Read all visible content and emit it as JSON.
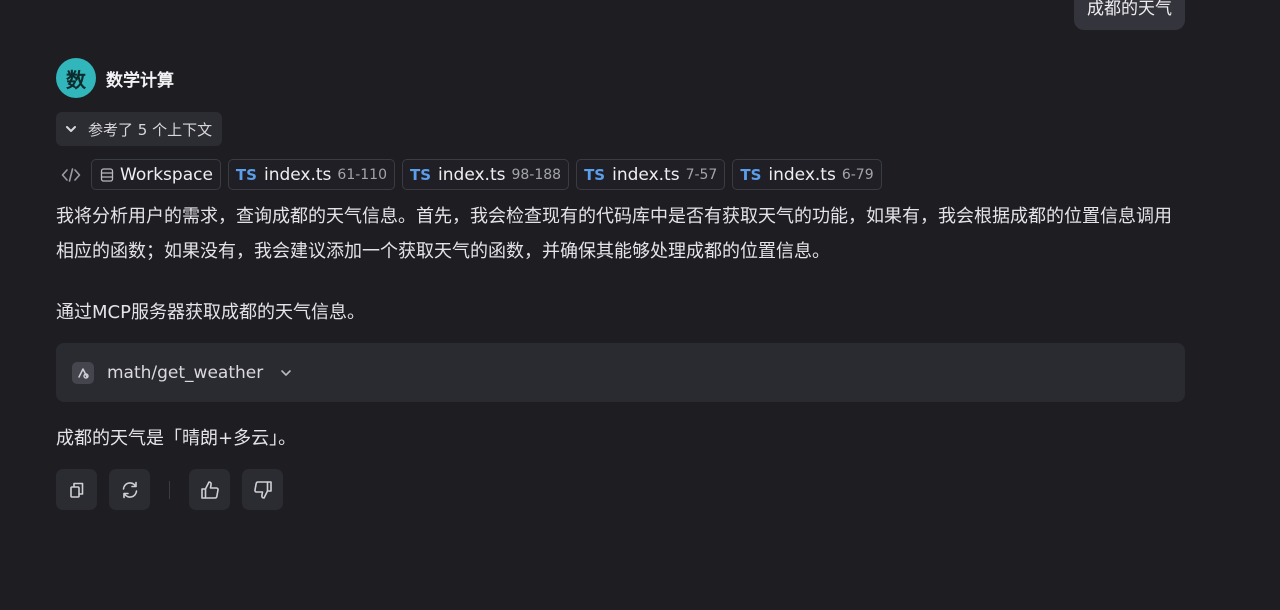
{
  "user_message": {
    "text": "成都的天气"
  },
  "agent": {
    "avatar_char": "数",
    "name": "数学计算",
    "accent": "#30b6bb"
  },
  "context": {
    "label": "参考了 5 个上下文"
  },
  "references": [
    {
      "type": "workspace",
      "name": "Workspace"
    },
    {
      "type": "ts",
      "badge": "TS",
      "name": "index.ts",
      "range": "61-110"
    },
    {
      "type": "ts",
      "badge": "TS",
      "name": "index.ts",
      "range": "98-188"
    },
    {
      "type": "ts",
      "badge": "TS",
      "name": "index.ts",
      "range": "7-57"
    },
    {
      "type": "ts",
      "badge": "TS",
      "name": "index.ts",
      "range": "6-79"
    }
  ],
  "answer": {
    "paragraph1": "我将分析用户的需求，查询成都的天气信息。首先，我会检查现有的代码库中是否有获取天气的功能，如果有，我会根据成都的位置信息调用相应的函数；如果没有，我会建议添加一个获取天气的函数，并确保其能够处理成都的位置信息。",
    "paragraph2": "通过MCP服务器获取成都的天气信息。",
    "tool_call": {
      "name": "math/get_weather"
    },
    "paragraph3": "成都的天气是「晴朗+多云」。"
  },
  "actions": [
    "copy-icon",
    "regenerate-icon",
    "thumbs-up-icon",
    "thumbs-down-icon"
  ],
  "colors": {
    "background": "#1d1d22",
    "ts_badge": "#5c9eea"
  }
}
